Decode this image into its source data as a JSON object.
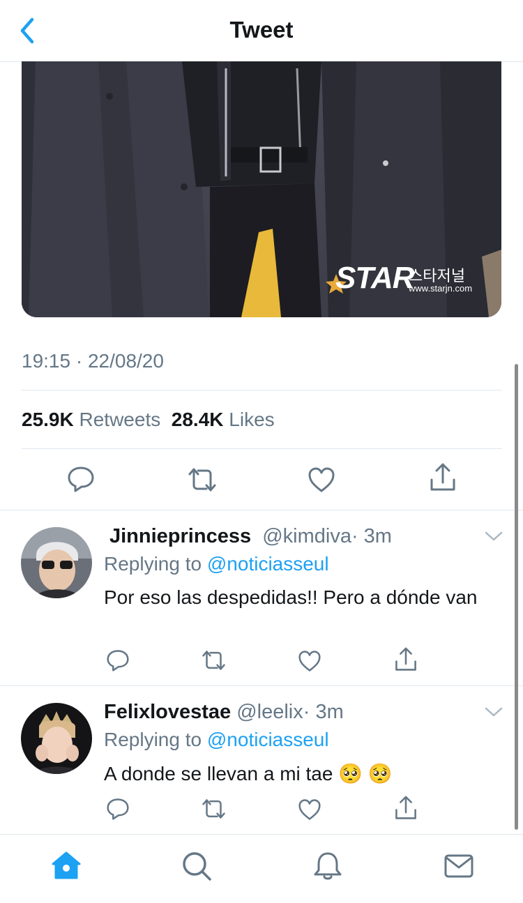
{
  "header": {
    "title": "Tweet"
  },
  "media": {
    "watermark_brand": "STAR",
    "watermark_korean": "스타저널",
    "watermark_url": "www.starjn.com"
  },
  "tweet": {
    "timestamp": "19:15 · 22/08/20",
    "retweets_count": "25.9K",
    "retweets_label": "Retweets",
    "likes_count": "28.4K",
    "likes_label": "Likes"
  },
  "replies": [
    {
      "name": "Jinnieprincess",
      "handle": "@kimdiva",
      "time": "· 3m",
      "replying_label": "Replying to",
      "replying_to": "@noticiasseul",
      "text": "Por eso las despedidas!! Pero a dónde van"
    },
    {
      "name": "Felixlovestae",
      "handle": "@leelix",
      "time": "· 3m",
      "replying_label": "Replying to",
      "replying_to": "@noticiasseul",
      "text": "A donde se llevan a mi tae 🥺 🥺"
    }
  ],
  "colors": {
    "accent": "#1da1f2",
    "secondary_text": "#657786",
    "divider": "#e1e8ed"
  },
  "icons": {
    "back": "chevron-left-icon",
    "actions": [
      "reply-icon",
      "retweet-icon",
      "like-icon",
      "share-icon"
    ],
    "tabs": [
      "home-icon",
      "search-icon",
      "notifications-icon",
      "messages-icon"
    ]
  }
}
